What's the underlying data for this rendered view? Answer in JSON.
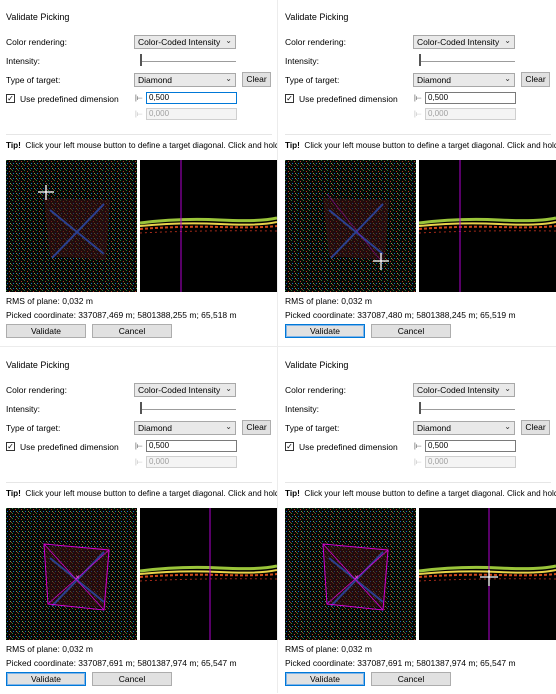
{
  "panels": [
    {
      "title": "Validate Picking",
      "color_rendering_label": "Color rendering:",
      "color_rendering_value": "Color-Coded Intensity",
      "intensity_label": "Intensity:",
      "target_label": "Type of target:",
      "target_value": "Diamond",
      "clear_label": "Clear",
      "use_dim_label": "Use predefined dimension",
      "dim_value": "0,500",
      "dim2_value": "0,000",
      "tip_label": "Tip!",
      "tip_text": "Click your left mouse button to define a target diagonal. Click and hold th",
      "rms": "RMS of plane: 0,032 m",
      "picked": "Picked coordinate: 337087,469 m; 5801388,255 m; 65,518 m",
      "validate_label": "Validate",
      "cancel_label": "Cancel"
    },
    {
      "title": "Validate Picking",
      "color_rendering_label": "Color rendering:",
      "color_rendering_value": "Color-Coded Intensity",
      "intensity_label": "Intensity:",
      "target_label": "Type of target:",
      "target_value": "Diamond",
      "clear_label": "Clear",
      "use_dim_label": "Use predefined dimension",
      "dim_value": "0,500",
      "dim2_value": "0,000",
      "tip_label": "Tip!",
      "tip_text": "Click your left mouse button to define a target diagonal. Click and hold th",
      "rms": "RMS of plane: 0,032 m",
      "picked": "Picked coordinate: 337087,480 m; 5801388,245 m; 65,519 m",
      "validate_label": "Validate",
      "cancel_label": "Cancel"
    },
    {
      "title": "Validate Picking",
      "color_rendering_label": "Color rendering:",
      "color_rendering_value": "Color-Coded Intensity",
      "intensity_label": "Intensity:",
      "target_label": "Type of target:",
      "target_value": "Diamond",
      "clear_label": "Clear",
      "use_dim_label": "Use predefined dimension",
      "dim_value": "0,500",
      "dim2_value": "0,000",
      "tip_label": "Tip!",
      "tip_text": "Click your left mouse button to define a target diagonal. Click and hold th",
      "rms": "RMS of plane: 0,032 m",
      "picked": "Picked coordinate: 337087,691 m; 5801387,974 m; 65,547 m",
      "validate_label": "Validate",
      "cancel_label": "Cancel"
    },
    {
      "title": "Validate Picking",
      "color_rendering_label": "Color rendering:",
      "color_rendering_value": "Color-Coded Intensity",
      "intensity_label": "Intensity:",
      "target_label": "Type of target:",
      "target_value": "Diamond",
      "clear_label": "Clear",
      "use_dim_label": "Use predefined dimension",
      "dim_value": "0,500",
      "dim2_value": "0,000",
      "tip_label": "Tip!",
      "tip_text": "Click your left mouse button to define a target diagonal. Click and hold th",
      "rms": "RMS of plane: 0,032 m",
      "picked": "Picked coordinate: 337087,691 m; 5801387,974 m; 65,547 m",
      "validate_label": "Validate",
      "cancel_label": "Cancel"
    }
  ],
  "icons": {
    "check": "checkmark-icon",
    "chevron": "chevron-down-icon",
    "dimension": "dimension-icon",
    "crosshair": "crosshair-icon"
  },
  "colors": {
    "focus": "#0078d7",
    "diamond": "#d000d0",
    "vline": "#b000d0",
    "cursor": "#ffffff"
  }
}
